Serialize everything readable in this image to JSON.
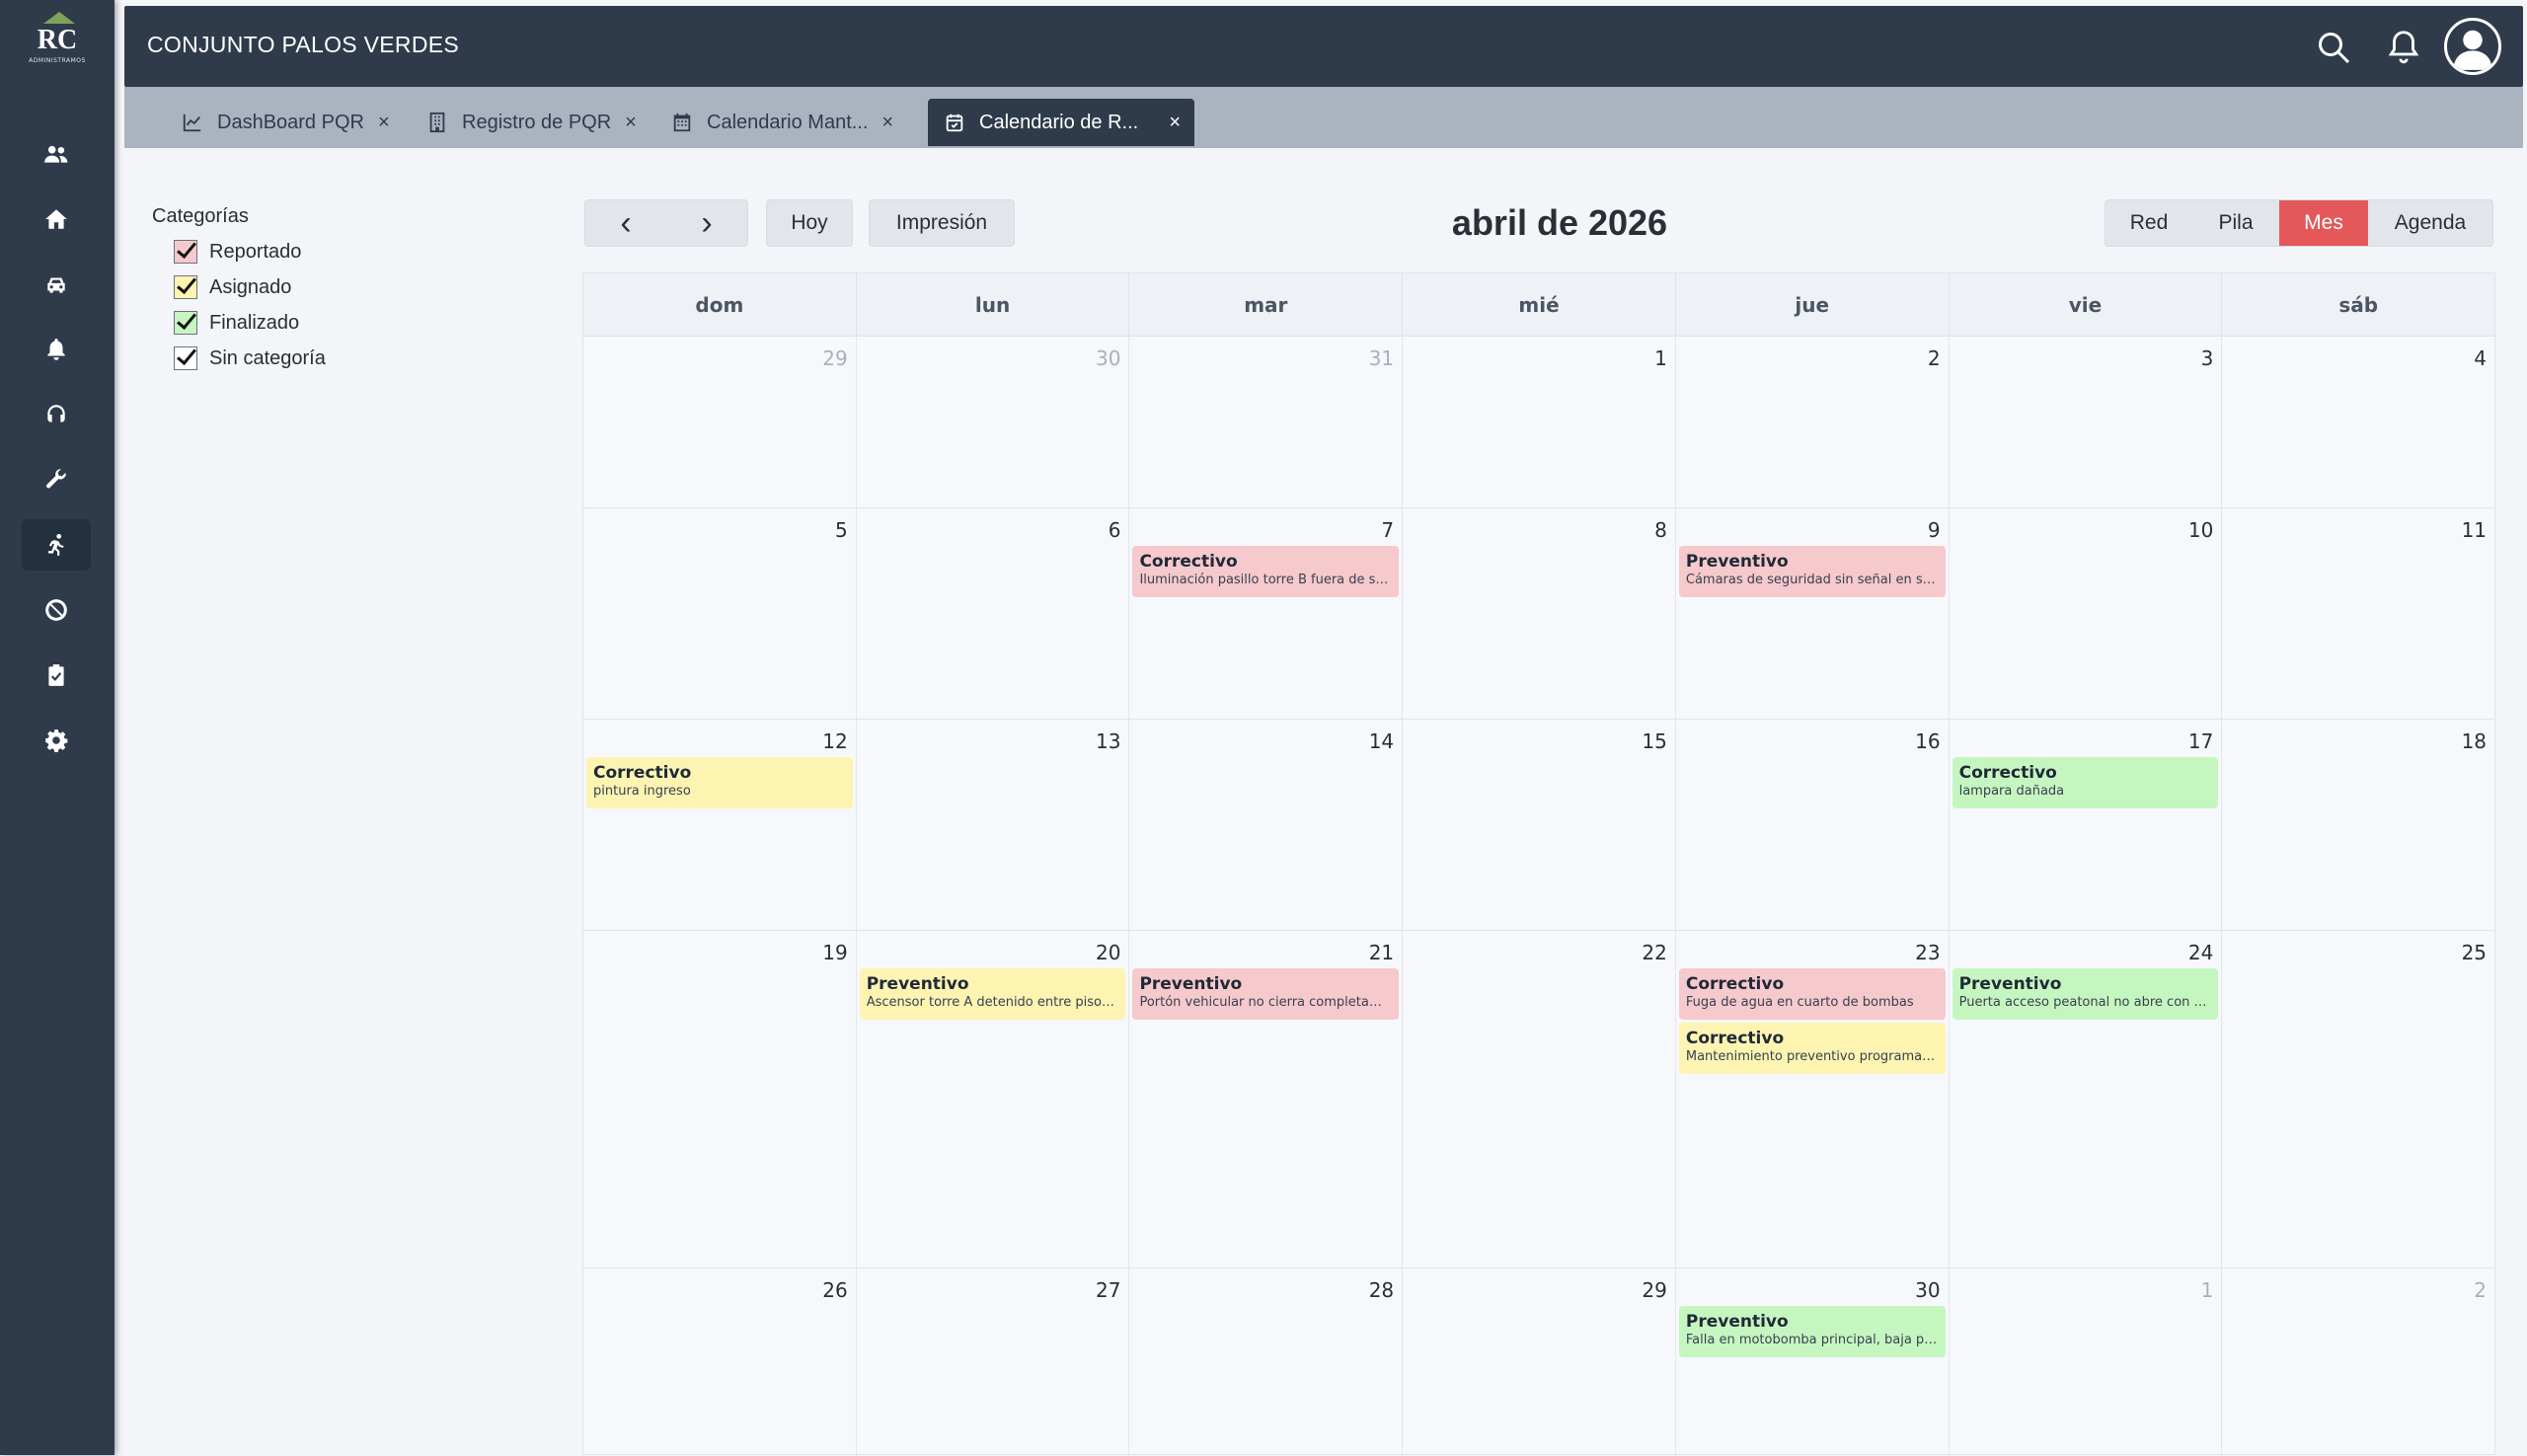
{
  "app": {
    "title": "CONJUNTO PALOS VERDES"
  },
  "logo": {
    "mark": "RC",
    "sub": "ADMINISTRAMOS"
  },
  "tabs": [
    {
      "label": "DashBoard PQR",
      "icon": "chart-line-icon",
      "close": "×"
    },
    {
      "label": "Registro de PQR",
      "icon": "building-icon",
      "close": "×"
    },
    {
      "label": "Calendario Mant...",
      "icon": "calendar-icon",
      "close": "×"
    },
    {
      "label": "Calendario de R...",
      "icon": "calendar-check-icon",
      "close": "×",
      "active": true
    }
  ],
  "sidebar": {
    "items": [
      "users-icon",
      "home-icon",
      "car-icon",
      "bell-icon",
      "headset-icon",
      "wrench-icon",
      "running-icon",
      "ban-icon",
      "clipboard-check-icon",
      "gear-icon"
    ],
    "active_index": 6
  },
  "categories": {
    "title": "Categorías",
    "items": [
      {
        "label": "Reportado",
        "color": "#f6c9cc"
      },
      {
        "label": "Asignado",
        "color": "#fdf4b2"
      },
      {
        "label": "Finalizado",
        "color": "#c6f6c0"
      },
      {
        "label": "Sin categoría",
        "color": "#ffffff"
      }
    ]
  },
  "toolbar": {
    "prev": "‹",
    "next": "›",
    "today": "Hoy",
    "print": "Impresión"
  },
  "calendar_title": "abril de 2026",
  "views": [
    {
      "label": "Red"
    },
    {
      "label": "Pila"
    },
    {
      "label": "Mes",
      "active": true
    },
    {
      "label": "Agenda"
    }
  ],
  "weekdays": [
    "dom",
    "lun",
    "mar",
    "mié",
    "jue",
    "vie",
    "sáb"
  ],
  "colors": {
    "reportado": "#f6c9cc",
    "asignado": "#fdf4b2",
    "finalizado": "#c6f6c0",
    "accent": "#e5585a",
    "nav": "#2f3b4b"
  },
  "weeks": [
    {
      "days": [
        {
          "n": "29",
          "o": true
        },
        {
          "n": "30",
          "o": true
        },
        {
          "n": "31",
          "o": true
        },
        {
          "n": "1"
        },
        {
          "n": "2"
        },
        {
          "n": "3"
        },
        {
          "n": "4"
        }
      ]
    },
    {
      "days": [
        {
          "n": "5"
        },
        {
          "n": "6"
        },
        {
          "n": "7",
          "events": [
            {
              "title": "Correctivo",
              "desc": "Iluminación pasillo torre B fuera de se...",
              "cat": "reportado"
            }
          ]
        },
        {
          "n": "8"
        },
        {
          "n": "9",
          "events": [
            {
              "title": "Preventivo",
              "desc": "Cámaras de seguridad sin señal en só...",
              "cat": "reportado"
            }
          ]
        },
        {
          "n": "10"
        },
        {
          "n": "11"
        }
      ]
    },
    {
      "days": [
        {
          "n": "12",
          "events": [
            {
              "title": "Correctivo",
              "desc": "pintura ingreso",
              "cat": "asignado"
            }
          ]
        },
        {
          "n": "13"
        },
        {
          "n": "14"
        },
        {
          "n": "15"
        },
        {
          "n": "16"
        },
        {
          "n": "17",
          "events": [
            {
              "title": "Correctivo",
              "desc": "lampara dañada",
              "cat": "finalizado"
            }
          ]
        },
        {
          "n": "18"
        }
      ]
    },
    {
      "days": [
        {
          "n": "19"
        },
        {
          "n": "20",
          "events": [
            {
              "title": "Preventivo",
              "desc": "Ascensor torre A detenido entre pisos,...",
              "cat": "asignado"
            }
          ]
        },
        {
          "n": "21",
          "events": [
            {
              "title": "Preventivo",
              "desc": "Portón vehicular no cierra completam...",
              "cat": "reportado"
            }
          ]
        },
        {
          "n": "22"
        },
        {
          "n": "23",
          "events": [
            {
              "title": "Correctivo",
              "desc": "Fuga de agua en cuarto de bombas",
              "cat": "reportado"
            },
            {
              "title": "Correctivo",
              "desc": "Mantenimiento preventivo programad...",
              "cat": "asignado"
            }
          ]
        },
        {
          "n": "24",
          "events": [
            {
              "title": "Preventivo",
              "desc": "Puerta acceso peatonal no abre con ta...",
              "cat": "finalizado"
            }
          ]
        },
        {
          "n": "25"
        }
      ]
    },
    {
      "days": [
        {
          "n": "26"
        },
        {
          "n": "27"
        },
        {
          "n": "28"
        },
        {
          "n": "29"
        },
        {
          "n": "30",
          "events": [
            {
              "title": "Preventivo",
              "desc": "Falla en motobomba principal, baja pr...",
              "cat": "finalizado"
            }
          ]
        },
        {
          "n": "1",
          "o": true
        },
        {
          "n": "2",
          "o": true
        }
      ]
    }
  ]
}
